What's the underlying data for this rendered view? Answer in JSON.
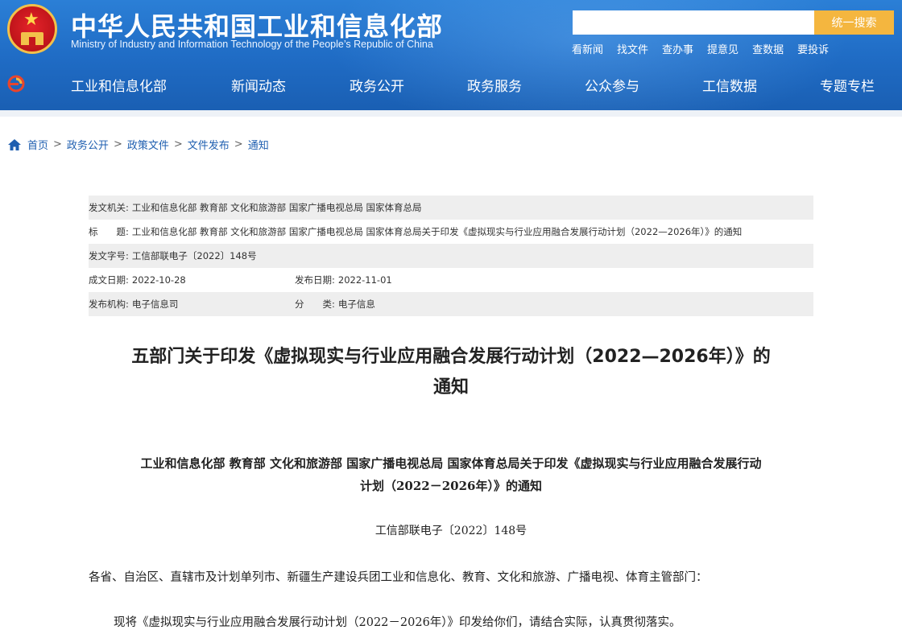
{
  "header": {
    "title_cn": "中华人民共和国工业和信息化部",
    "title_en": "Ministry of Industry and Information Technology of the People’s Republic of China",
    "search": {
      "placeholder": "",
      "button_label": "统一搜索"
    },
    "quick_links": [
      "看新闻",
      "找文件",
      "查办事",
      "提意见",
      "查数据",
      "要投诉"
    ],
    "nav": [
      "工业和信息化部",
      "新闻动态",
      "政务公开",
      "政务服务",
      "公众参与",
      "工信数据",
      "专题专栏"
    ]
  },
  "breadcrumb": [
    "首页",
    "政务公开",
    "政策文件",
    "文件发布",
    "通知"
  ],
  "breadcrumb_sep": ">",
  "meta": {
    "issuer_label": "发文机关:",
    "issuer": "工业和信息化部 教育部 文化和旅游部 国家广播电视总局 国家体育总局",
    "title_label": "标　　题:",
    "title": "工业和信息化部 教育部 文化和旅游部 国家广播电视总局 国家体育总局关于印发《虚拟现实与行业应用融合发展行动计划（2022—2026年）》的通知",
    "doc_no_label": "发文字号:",
    "doc_no": "工信部联电子〔2022〕148号",
    "written_label": "成文日期:",
    "written": "2022-10-28",
    "published_label": "发布日期:",
    "published": "2022-11-01",
    "org_label": "发布机构:",
    "org": "电子信息司",
    "category_label": "分　　类:",
    "category": "电子信息"
  },
  "article": {
    "title_line1": "五部门关于印发《虚拟现实与行业应用融合发展行动计划（2022—2026年）》的",
    "title_line2": "通知",
    "sub_line1": "工业和信息化部 教育部 文化和旅游部 国家广播电视总局 国家体育总局关于印发《虚拟现实与行业应用融合发展行动",
    "sub_line2": "计划（2022－2026年）》的通知",
    "doc_no": "工信部联电子〔2022〕148号",
    "para1": "各省、自治区、直辖市及计划单列市、新疆生产建设兵团工业和信息化、教育、文化和旅游、广播电视、体育主管部门：",
    "para2": "现将《虚拟现实与行业应用融合发展行动计划（2022－2026年）》印发给你们，请结合实际，认真贯彻落实。"
  },
  "colors": {
    "header_blue": "#1f6bc4",
    "search_button": "#f4b63f",
    "link_blue": "#1f5fb0",
    "meta_shade": "#eeeeee"
  },
  "icons": [
    "national-emblem-icon",
    "nav-logo-icon",
    "home-icon"
  ]
}
